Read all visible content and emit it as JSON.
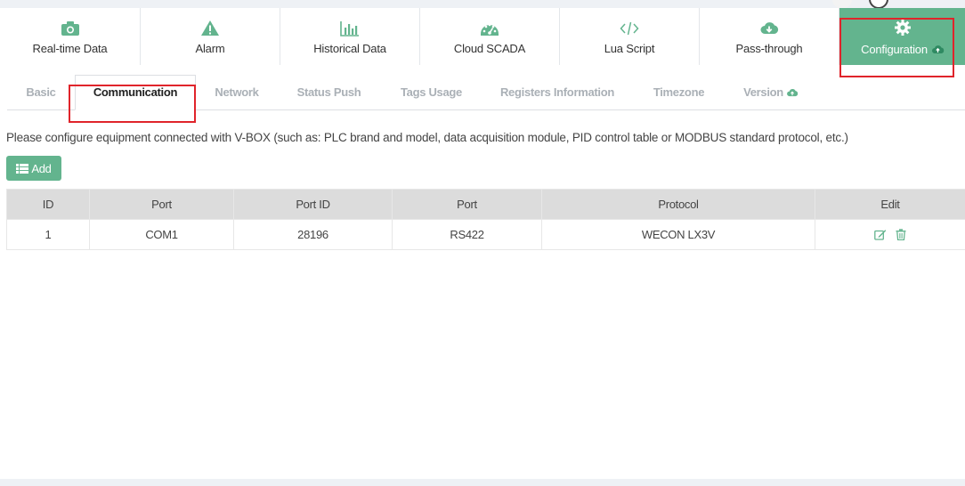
{
  "nav": {
    "items": [
      {
        "label": "Real-time Data",
        "icon": "camera-icon"
      },
      {
        "label": "Alarm",
        "icon": "warning-icon"
      },
      {
        "label": "Historical Data",
        "icon": "bar-chart-icon"
      },
      {
        "label": "Cloud SCADA",
        "icon": "dashboard-icon"
      },
      {
        "label": "Lua Script",
        "icon": "code-icon"
      },
      {
        "label": "Pass-through",
        "icon": "cloud-download-icon"
      },
      {
        "label": "Configuration",
        "icon": "gear-icon",
        "active": true
      }
    ]
  },
  "tabs": [
    {
      "label": "Basic"
    },
    {
      "label": "Communication",
      "active": true
    },
    {
      "label": "Network"
    },
    {
      "label": "Status Push"
    },
    {
      "label": "Tags Usage"
    },
    {
      "label": "Registers Information"
    },
    {
      "label": "Timezone"
    },
    {
      "label": "Version"
    }
  ],
  "description": "Please configure equipment connected with V-BOX (such as: PLC brand and model, data acquisition module, PID control table or MODBUS standard protocol, etc.)",
  "add_button": {
    "label": "Add"
  },
  "table": {
    "headers": [
      "ID",
      "Port",
      "Port ID",
      "Port",
      "Protocol",
      "Edit"
    ],
    "rows": [
      {
        "id": "1",
        "port": "COM1",
        "port_id": "28196",
        "port_type": "RS422",
        "protocol": "WECON LX3V"
      }
    ]
  },
  "colors": {
    "accent": "#63b48e",
    "highlight": "#e0242b"
  }
}
